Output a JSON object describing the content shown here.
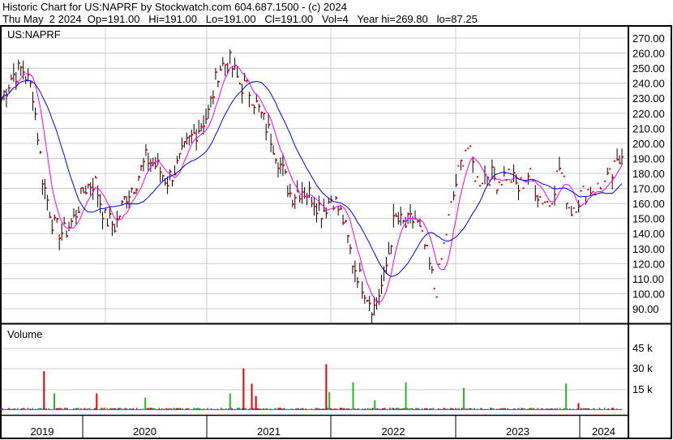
{
  "header": {
    "title": "Historic Chart for US:NAPRF by Stockwatch.com 604.687.1500 - (c) 2024",
    "quote": "Thu May  2 2024  Op=191.00   Hi=191.00   Lo=191.00   Cl=191.00   Vol=4   Year hi=269.80   lo=87.25"
  },
  "chart_data": {
    "type": "line",
    "symbol": "US:NAPRF",
    "volume_label": "Volume",
    "price_ticks": [
      "270.00",
      "260.00",
      "250.00",
      "240.00",
      "230.00",
      "220.00",
      "210.00",
      "200.00",
      "190.00",
      "180.00",
      "170.00",
      "160.00",
      "150.00",
      "140.00",
      "130.00",
      "120.00",
      "110.00",
      "100.00",
      "90.00"
    ],
    "price_range": [
      82,
      278
    ],
    "volume_ticks": [
      "45 k",
      "30 k",
      "15 k"
    ],
    "volume_range": [
      0,
      55000
    ],
    "years": [
      "2019",
      "2020",
      "2021",
      "2022",
      "2023",
      "2024"
    ],
    "start_month": "2019-05",
    "monthly_close": [
      230,
      245,
      250,
      235,
      175,
      145,
      140,
      150,
      170,
      175,
      150,
      145,
      165,
      175,
      190,
      185,
      175,
      185,
      200,
      210,
      220,
      250,
      255,
      240,
      235,
      220,
      205,
      185,
      165,
      170,
      165,
      155,
      165,
      150,
      120,
      105,
      90,
      110,
      150,
      145,
      150,
      130,
      100,
      140,
      175,
      200,
      175,
      180,
      175,
      180,
      170,
      180,
      165,
      160,
      185,
      155,
      165,
      170,
      170,
      178,
      191
    ],
    "volume_spikes": [
      {
        "m": 4.1,
        "v": 28000,
        "c": "red"
      },
      {
        "m": 5.1,
        "v": 12000,
        "c": "green"
      },
      {
        "m": 9.2,
        "v": 12000,
        "c": "red"
      },
      {
        "m": 13.9,
        "v": 9000,
        "c": "green"
      },
      {
        "m": 22.1,
        "v": 12000,
        "c": "green"
      },
      {
        "m": 23.4,
        "v": 30000,
        "c": "red"
      },
      {
        "m": 24.2,
        "v": 19000,
        "c": "red"
      },
      {
        "m": 24.6,
        "v": 10000,
        "c": "red"
      },
      {
        "m": 31.4,
        "v": 33000,
        "c": "red"
      },
      {
        "m": 31.7,
        "v": 13000,
        "c": "green"
      },
      {
        "m": 34.0,
        "v": 20000,
        "c": "green"
      },
      {
        "m": 36.1,
        "v": 7000,
        "c": "green"
      },
      {
        "m": 39.1,
        "v": 20000,
        "c": "green"
      },
      {
        "m": 44.7,
        "v": 16000,
        "c": "green"
      },
      {
        "m": 54.6,
        "v": 19000,
        "c": "green"
      },
      {
        "m": 55.8,
        "v": 5000,
        "c": "red"
      }
    ],
    "series": [
      {
        "name": "Price",
        "color": "#000000"
      },
      {
        "name": "Short MA",
        "color": "#ff00ff"
      },
      {
        "name": "Long MA",
        "color": "#0000ff"
      }
    ]
  }
}
